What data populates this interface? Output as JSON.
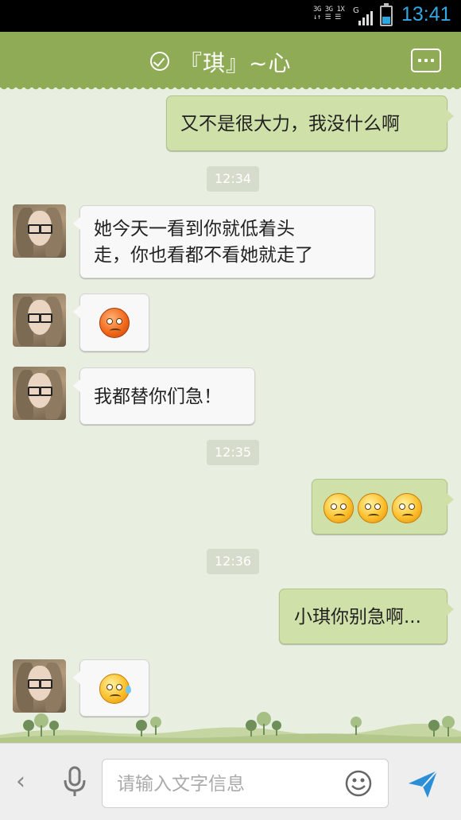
{
  "status_bar": {
    "net_line1": "3G 3G 1X",
    "net_line2": "↓↑ ☰ ☰",
    "net_type": "G",
    "time": "13:41",
    "time_color": "#35a6e0"
  },
  "header": {
    "title": "『琪』~心",
    "status_icon": "check-circle-icon",
    "menu_icon": "more-icon",
    "color": "#8fab56"
  },
  "messages": {
    "m1": {
      "text": "又不是很大力，我没什么啊"
    },
    "t1": "12:34",
    "m2": {
      "line1": "她今天一看到你就低着头",
      "line2": "走，你也看都不看她就走了"
    },
    "m3": {
      "emoji": "angry-face-icon"
    },
    "m4": {
      "text": "我都替你们急！"
    },
    "t2": "12:35",
    "m5": {
      "emoji": "worried-face-icon x3"
    },
    "t3": "12:36",
    "m6": {
      "text": "小琪你别急啊..."
    },
    "m7": {
      "emoji": "sweat-face-icon"
    }
  },
  "input_bar": {
    "placeholder": "请输入文字信息",
    "back_icon": "chevron-left-icon",
    "mic_icon": "microphone-icon",
    "emoji_icon": "smiley-icon",
    "send_icon": "send-icon",
    "send_color": "#2a8fd6"
  }
}
